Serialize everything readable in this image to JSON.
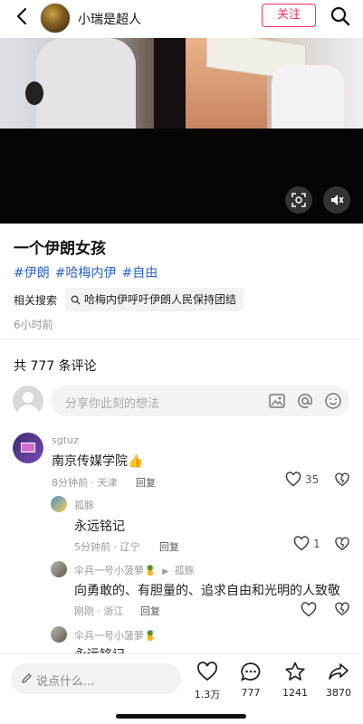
{
  "header": {
    "author": "小瑞是超人",
    "follow_label": "关注"
  },
  "post": {
    "title": "一个伊朗女孩",
    "tags": [
      "#伊朗",
      "#哈梅内伊",
      "#自由"
    ],
    "related_label": "相关搜索",
    "related_query": "哈梅内伊呼吁伊朗人民保持团结",
    "time_ago": "6小时前"
  },
  "comments_section": {
    "count_label": "共 777 条评论",
    "input_placeholder": "分享你此刻的想法"
  },
  "comments": [
    {
      "name": "sgtuz",
      "text": "南京传媒学院👍",
      "meta": "8分钟前 · 天津",
      "reply": "回复",
      "likes": "35"
    },
    {
      "name": "孤豚",
      "text": "永远铭记",
      "meta": "5分钟前 · 辽宁",
      "reply": "回复",
      "likes": "1"
    },
    {
      "name": "伞兵一号小菠萝🍍",
      "reply_to": "孤豚",
      "text": "向勇敢的、有胆量的、追求自由和光明的人致敬",
      "meta": "刚刚 · 浙江",
      "reply": "回复"
    },
    {
      "name": "伞兵一号小菠萝🍍",
      "text": "永远铭记"
    }
  ],
  "bottom_bar": {
    "say_placeholder": "说点什么...",
    "likes": "1.3万",
    "comments": "777",
    "stars": "1241",
    "shares": "3870"
  },
  "colors": {
    "accent": "#ff2d55",
    "tag": "#2a64c9"
  }
}
